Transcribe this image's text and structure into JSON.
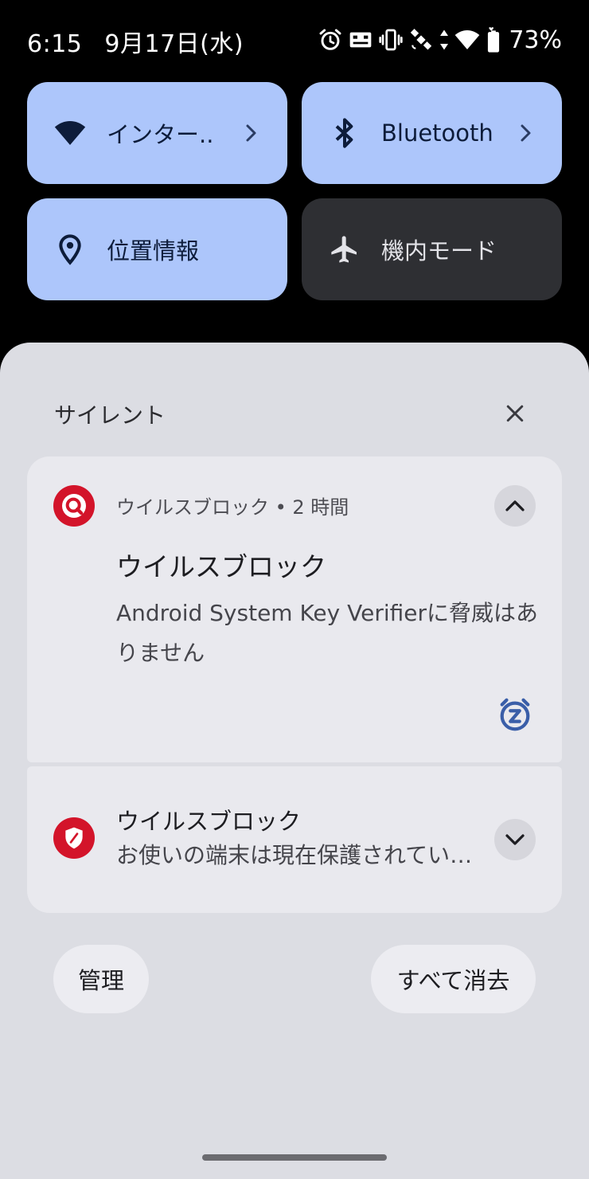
{
  "status_bar": {
    "time": "6:15",
    "date": "9月17日(水)",
    "battery_percent": "73%",
    "icons": [
      "alarm-icon",
      "cast-icon",
      "vibrate-icon",
      "satellite-icon",
      "data-arrows-icon",
      "wifi-icon",
      "battery-icon"
    ]
  },
  "quick_settings": {
    "internet": {
      "label": "インター..",
      "icon": "wifi-icon",
      "active": true
    },
    "bluetooth": {
      "label": "Bluetooth",
      "icon": "bluetooth-icon",
      "active": true
    },
    "location": {
      "label": "位置情報",
      "icon": "location-pin-icon",
      "active": true
    },
    "airplane": {
      "label": "機内モード",
      "icon": "airplane-icon",
      "active": false
    }
  },
  "notifications": {
    "section_title": "サイレント",
    "items": [
      {
        "app_header": "ウイルスブロック • 2 時間",
        "title": "ウイルスブロック",
        "body": "Android System Key Verifierに脅威はありません",
        "icon": "search-shield-icon",
        "expanded": true
      },
      {
        "title": "ウイルスブロック",
        "body": "お使いの端末は現在保護されています",
        "icon": "shield-icon",
        "expanded": false
      }
    ]
  },
  "actions": {
    "manage": "管理",
    "clear_all": "すべて消去"
  },
  "colors": {
    "tile_active": "#adc6fb",
    "tile_inactive": "#2e2f33",
    "shade": "#dcdde3",
    "card": "#e9e9ee",
    "app_accent": "#d3142a",
    "snooze": "#3a5ea8"
  }
}
